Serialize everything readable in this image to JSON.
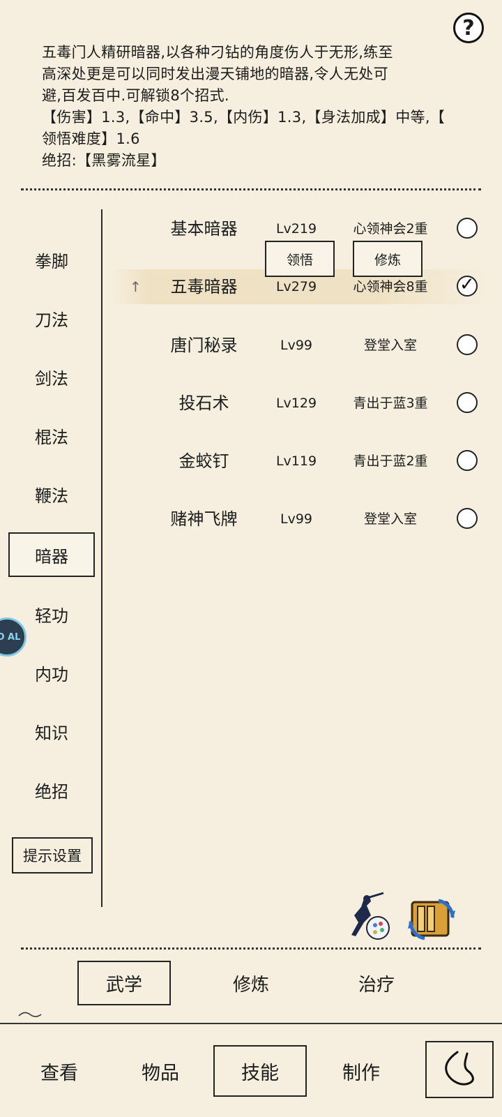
{
  "help": {
    "symbol": "?"
  },
  "description": {
    "line1": "五毒门人精研暗器,以各种刁钻的角度伤人于无形,练至",
    "line2": "高深处更是可以同时发出漫天铺地的暗器,令人无处可",
    "line3": "避,百发百中.可解锁8个招式.",
    "line4": "【伤害】1.3,【命中】3.5,【内伤】1.3,【身法加成】中等,【",
    "line5": "领悟难度】1.6",
    "line6": "绝招:【黑雾流星】"
  },
  "categories": [
    "拳脚",
    "刀法",
    "剑法",
    "棍法",
    "鞭法",
    "暗器",
    "轻功",
    "内功",
    "知识",
    "绝招"
  ],
  "active_category": "暗器",
  "hint_settings": "提示设置",
  "skills": [
    {
      "name": "基本暗器",
      "level": "Lv219",
      "stage": "心领神会2重",
      "selected": false
    },
    {
      "name": "五毒暗器",
      "level": "Lv279",
      "stage": "心领神会8重",
      "selected": true
    },
    {
      "name": "唐门秘录",
      "level": "Lv99",
      "stage": "登堂入室",
      "selected": false
    },
    {
      "name": "投石术",
      "level": "Lv129",
      "stage": "青出于蓝3重",
      "selected": false
    },
    {
      "name": "金蛟钉",
      "level": "Lv119",
      "stage": "青出于蓝2重",
      "selected": false
    },
    {
      "name": "赌神飞牌",
      "level": "Lv99",
      "stage": "登堂入室",
      "selected": false
    }
  ],
  "actions": {
    "comprehend": "领悟",
    "practice": "修炼"
  },
  "sub_tabs": [
    "武学",
    "修炼",
    "治疗"
  ],
  "active_sub_tab": "武学",
  "bottom_tabs": [
    "查看",
    "物品",
    "技能",
    "制作"
  ],
  "active_bottom_tab": "技能",
  "badge_text": "JO AL",
  "colors": {
    "background": "#f6efdf",
    "selected_row": "#efe1c3"
  }
}
